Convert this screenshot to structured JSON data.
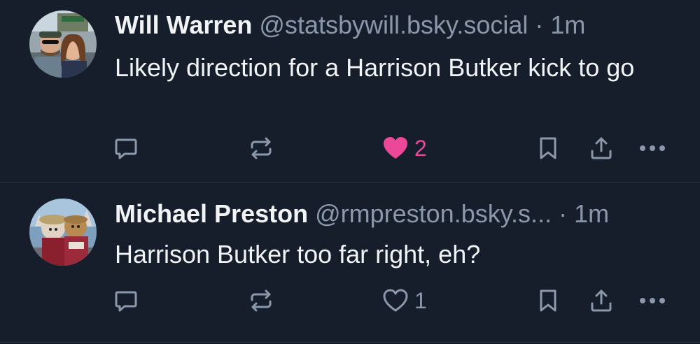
{
  "colors": {
    "background": "#161e2b",
    "text": "#f1f3f5",
    "muted": "#8b98ab",
    "like_active": "#ec4899",
    "divider": "#2a3444"
  },
  "posts": [
    {
      "author_name": "Will Warren",
      "handle": "@statsbywill.bsky.social",
      "separator": "·",
      "time": "1m",
      "text": "Likely direction for a Harrison Butker kick to go",
      "liked": true,
      "like_count": "2",
      "icons": [
        "reply-icon",
        "repost-icon",
        "heart-filled-icon",
        "bookmark-icon",
        "share-icon",
        "more-icon"
      ]
    },
    {
      "author_name": "Michael Preston",
      "handle": "@rmpreston.bsky.s...",
      "separator": "·",
      "time": "1m",
      "text": "Harrison Butker too far right, eh?",
      "liked": false,
      "like_count": "1",
      "icons": [
        "reply-icon",
        "repost-icon",
        "heart-outline-icon",
        "bookmark-icon",
        "share-icon",
        "more-icon"
      ]
    }
  ]
}
